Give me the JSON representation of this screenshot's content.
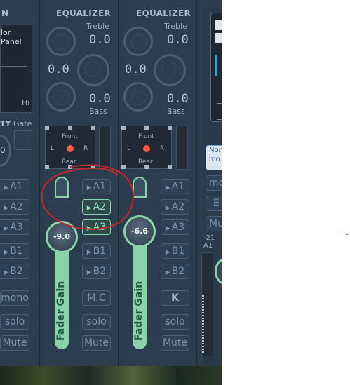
{
  "left_strip": {
    "title_fragment": "N",
    "panel_label": "lor Panel",
    "hi_label": "Hi",
    "intensity_fragment": "TY",
    "gate_label": "Gate",
    "gate_value": "0"
  },
  "strips": [
    {
      "eq_title": "EQUALIZER",
      "treble_label": "Treble",
      "treble_value": "0.0",
      "mid_value": "0.0",
      "bass_value": "0.0",
      "bass_label": "Bass",
      "pan": {
        "front": "Front",
        "rear": "Rear",
        "left": "L",
        "right": "R"
      },
      "buses": [
        "A1",
        "A2",
        "A3",
        "B1",
        "B2"
      ],
      "active_buses": [
        "A2",
        "A3"
      ],
      "mode_button": "M.C",
      "solo": "solo",
      "mute": "Mute",
      "fader_value": "-9.0",
      "fader_label": "Fader Gain"
    },
    {
      "eq_title": "EQUALIZER",
      "treble_label": "Treble",
      "treble_value": "0.0",
      "mid_value": "0.0",
      "bass_value": "0.0",
      "bass_label": "Bass",
      "pan": {
        "front": "Front",
        "rear": "Rear",
        "left": "L",
        "right": "R"
      },
      "buses": [
        "A1",
        "A2",
        "A3",
        "B1",
        "B2"
      ],
      "active_buses": [],
      "mode_button": "K",
      "solo": "solo",
      "mute": "Mute",
      "fader_value": "-6.6",
      "fader_label": "Fader Gain"
    }
  ],
  "left_buttons": {
    "buses": [
      "A1",
      "A2",
      "A3",
      "B1",
      "B2"
    ],
    "mono": "mono",
    "solo": "solo",
    "mute": "Mute"
  },
  "right_strip": {
    "mode_line1": "Nor",
    "mode_line2": "mo",
    "mono_fragment": "mo",
    "eq_fragment": "E",
    "mute_fragment": "Mu",
    "level_value": "-21",
    "bus_label": "A1"
  },
  "colors": {
    "panel_bg": "#2c3d4f",
    "accent_green": "#8ad2a8",
    "pan_dot": "#ff5a3a",
    "annotation_red": "#c0282a"
  }
}
